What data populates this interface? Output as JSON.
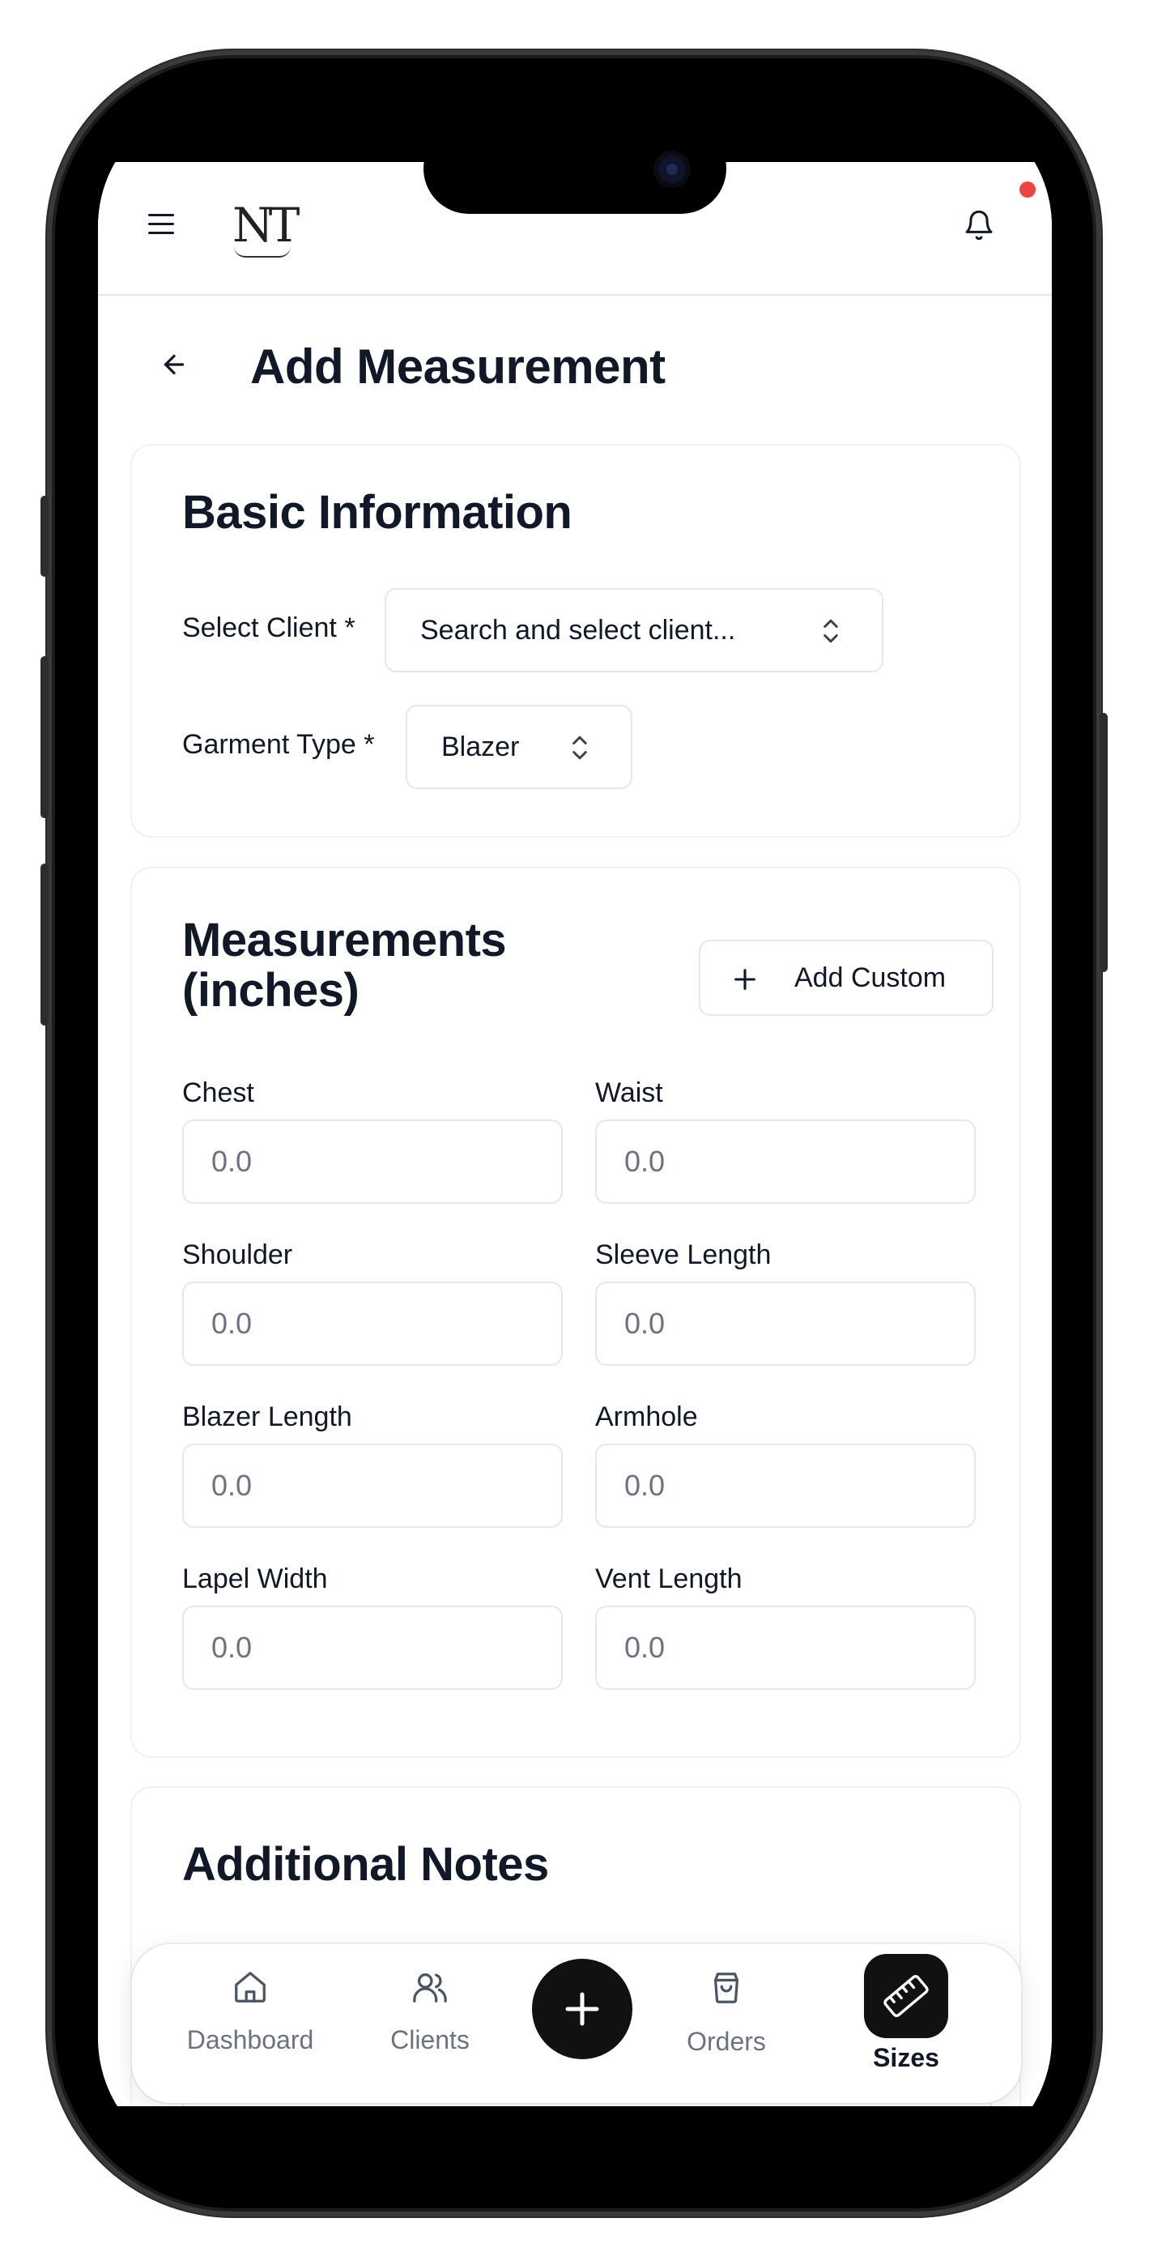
{
  "header": {
    "logo_text": "NT",
    "notification_dot_color": "#ef4444"
  },
  "page": {
    "title": "Add Measurement"
  },
  "basic_info": {
    "title": "Basic Information",
    "client_label": "Select Client *",
    "client_placeholder": "Search and select client...",
    "garment_label": "Garment Type *",
    "garment_value": "Blazer"
  },
  "measurements": {
    "title_line1": "Measurements",
    "title_line2": "(inches)",
    "add_custom_label": "Add Custom",
    "fields": [
      {
        "label": "Chest",
        "placeholder": "0.0"
      },
      {
        "label": "Waist",
        "placeholder": "0.0"
      },
      {
        "label": "Shoulder",
        "placeholder": "0.0"
      },
      {
        "label": "Sleeve Length",
        "placeholder": "0.0"
      },
      {
        "label": "Blazer Length",
        "placeholder": "0.0"
      },
      {
        "label": "Armhole",
        "placeholder": "0.0"
      },
      {
        "label": "Lapel Width",
        "placeholder": "0.0"
      },
      {
        "label": "Vent Length",
        "placeholder": "0.0"
      }
    ]
  },
  "notes": {
    "title": "Additional Notes"
  },
  "bottom_nav": {
    "items": [
      {
        "label": "Dashboard",
        "icon": "home-icon"
      },
      {
        "label": "Clients",
        "icon": "users-icon"
      },
      {
        "label": "Orders",
        "icon": "shopping-bag-icon"
      },
      {
        "label": "Sizes",
        "icon": "ruler-icon",
        "active": true
      }
    ],
    "fab_icon": "plus-icon"
  }
}
